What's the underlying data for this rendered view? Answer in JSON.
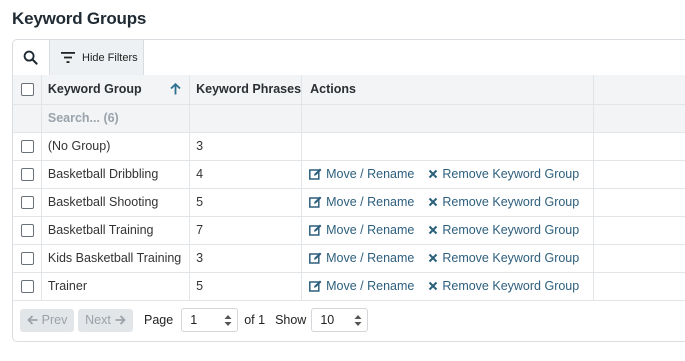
{
  "page": {
    "title": "Keyword Groups"
  },
  "toolbar": {
    "search_icon": "search-icon",
    "filters_label": "Hide Filters"
  },
  "table": {
    "headers": {
      "group": "Keyword Group",
      "phrases": "Keyword Phrases",
      "actions": "Actions"
    },
    "sort": "ascending",
    "filter_placeholder": "Search... (6)",
    "rows": [
      {
        "group": "(No Group)",
        "phrases": "3",
        "move": "",
        "remove": ""
      },
      {
        "group": "Basketball Dribbling",
        "phrases": "4",
        "move": "Move / Rename",
        "remove": "Remove Keyword Group"
      },
      {
        "group": "Basketball Shooting",
        "phrases": "5",
        "move": "Move / Rename",
        "remove": "Remove Keyword Group"
      },
      {
        "group": "Basketball Training",
        "phrases": "7",
        "move": "Move / Rename",
        "remove": "Remove Keyword Group"
      },
      {
        "group": "Kids Basketball Training",
        "phrases": "3",
        "move": "Move / Rename",
        "remove": "Remove Keyword Group"
      },
      {
        "group": "Trainer",
        "phrases": "5",
        "move": "Move / Rename",
        "remove": "Remove Keyword Group"
      }
    ]
  },
  "pagination": {
    "prev_label": "Prev",
    "next_label": "Next",
    "page_label": "Page",
    "page_value": "1",
    "of_label": "of 1",
    "show_label": "Show",
    "show_value": "10"
  },
  "colors": {
    "link": "#2d5f7d",
    "header_bg": "#f2f4f6",
    "sort_arrow": "#2d6f8f"
  }
}
